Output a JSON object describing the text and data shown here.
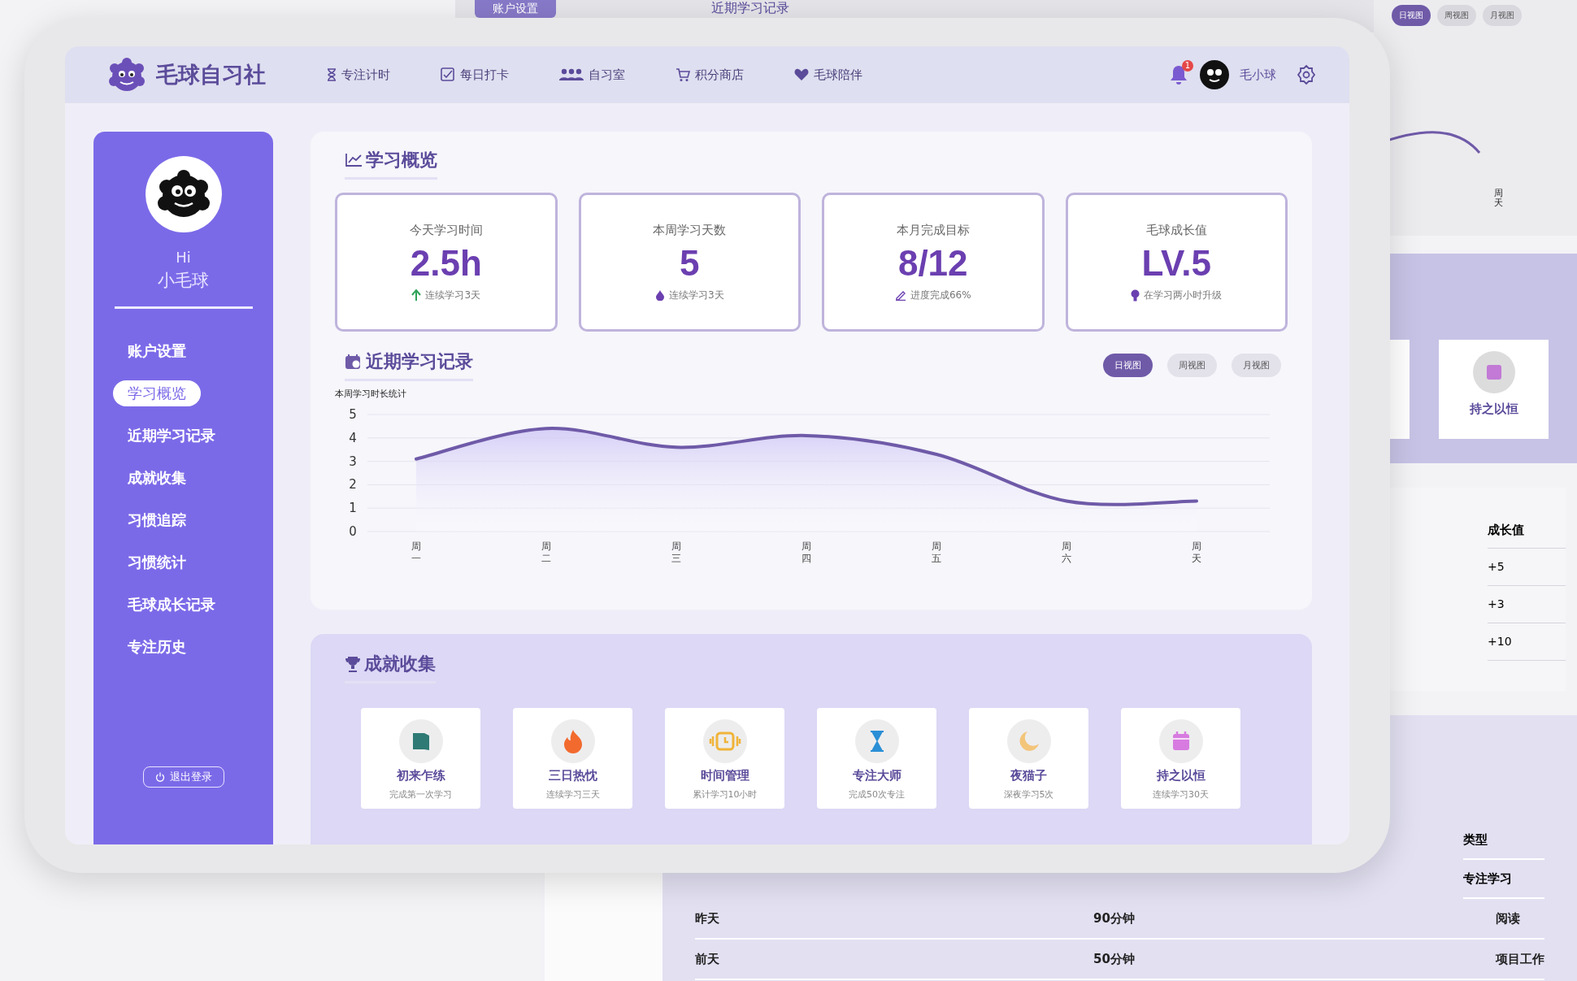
{
  "background": {
    "top_strip": {
      "button": "账户设置",
      "title": "近期学习记录"
    },
    "chart_panel": {
      "view_buttons": [
        {
          "label": "日视图",
          "selected": true
        },
        {
          "label": "周视图",
          "selected": false
        },
        {
          "label": "月视图",
          "selected": false
        }
      ],
      "axis_label": "周天"
    },
    "achievement_band": {
      "card_title": "持之以恒"
    },
    "growth_table": {
      "header": "成长值",
      "rows": [
        "+5",
        "+3",
        "+10"
      ]
    },
    "history_table": {
      "header_rows": [
        "类型",
        "专注学习"
      ],
      "rows": [
        [
          "昨天",
          "90分钟",
          "阅读"
        ],
        [
          "前天",
          "50分钟",
          "项目工作"
        ]
      ]
    }
  },
  "header": {
    "logo": "毛球自习社",
    "nav": [
      {
        "label": "专注计时",
        "kind": "hourglass"
      },
      {
        "label": "每日打卡",
        "kind": "checkbox"
      },
      {
        "label": "自习室",
        "kind": "people"
      },
      {
        "label": "积分商店",
        "kind": "cart"
      },
      {
        "label": "毛球陪伴",
        "kind": "heart"
      }
    ],
    "notification_count": "1",
    "user_name": "毛小球"
  },
  "sidebar": {
    "greeting": "Hi",
    "nickname": "小毛球",
    "items": [
      {
        "label": "账户设置",
        "selected": false
      },
      {
        "label": "学习概览",
        "selected": true
      },
      {
        "label": "近期学习记录",
        "selected": false
      },
      {
        "label": "成就收集",
        "selected": false
      },
      {
        "label": "习惯追踪",
        "selected": false
      },
      {
        "label": "习惯统计",
        "selected": false
      },
      {
        "label": "毛球成长记录",
        "selected": false
      },
      {
        "label": "专注历史",
        "selected": false
      }
    ],
    "logout": "退出登录"
  },
  "overview": {
    "title": "学习概览",
    "stats": [
      {
        "label": "今天学习时间",
        "value": "2.5h",
        "note": "连续学习3天",
        "kind": "arrow"
      },
      {
        "label": "本周学习天数",
        "value": "5",
        "note": "连续学习3天",
        "kind": "drop"
      },
      {
        "label": "本月完成目标",
        "value": "8/12",
        "note": "进度完成66%",
        "kind": "pen"
      },
      {
        "label": "毛球成长值",
        "value": "LV.5",
        "note": "在学习两小时升级",
        "kind": "bulb"
      }
    ]
  },
  "records": {
    "title": "近期学习记录",
    "view_buttons": [
      {
        "label": "日视图",
        "selected": true
      },
      {
        "label": "周视图",
        "selected": false
      },
      {
        "label": "月视图",
        "selected": false
      }
    ],
    "chart_data": {
      "type": "area",
      "title": "本周学习时长统计",
      "categories": [
        "周一",
        "周二",
        "周三",
        "周四",
        "周五",
        "周六",
        "周天"
      ],
      "series": [
        {
          "color": "#6f5aa8",
          "values": [
            3.1,
            4.4,
            3.6,
            4.1,
            3.3,
            1.3,
            1.3
          ]
        }
      ],
      "ylim": [
        0,
        5
      ],
      "yticks": [
        0,
        1,
        2,
        3,
        4,
        5
      ],
      "grid": true
    }
  },
  "achievements": {
    "title": "成就收集",
    "items": [
      {
        "name": "初来乍练",
        "desc": "完成第一次学习",
        "kind": "book",
        "color": "#2f7a74"
      },
      {
        "name": "三日热忱",
        "desc": "连续学习三天",
        "kind": "fire",
        "color": "#f26a2e"
      },
      {
        "name": "时间管理",
        "desc": "累计学习10小时",
        "kind": "clock",
        "color": "#f0b43a"
      },
      {
        "name": "专注大师",
        "desc": "完成50次专注",
        "kind": "hourglass",
        "color": "#2a8fd6"
      },
      {
        "name": "夜猫子",
        "desc": "深夜学习5次",
        "kind": "moon",
        "color": "#f3c57a"
      },
      {
        "name": "持之以恒",
        "desc": "连续学习30天",
        "kind": "calendar",
        "color": "#d77be0"
      }
    ]
  }
}
